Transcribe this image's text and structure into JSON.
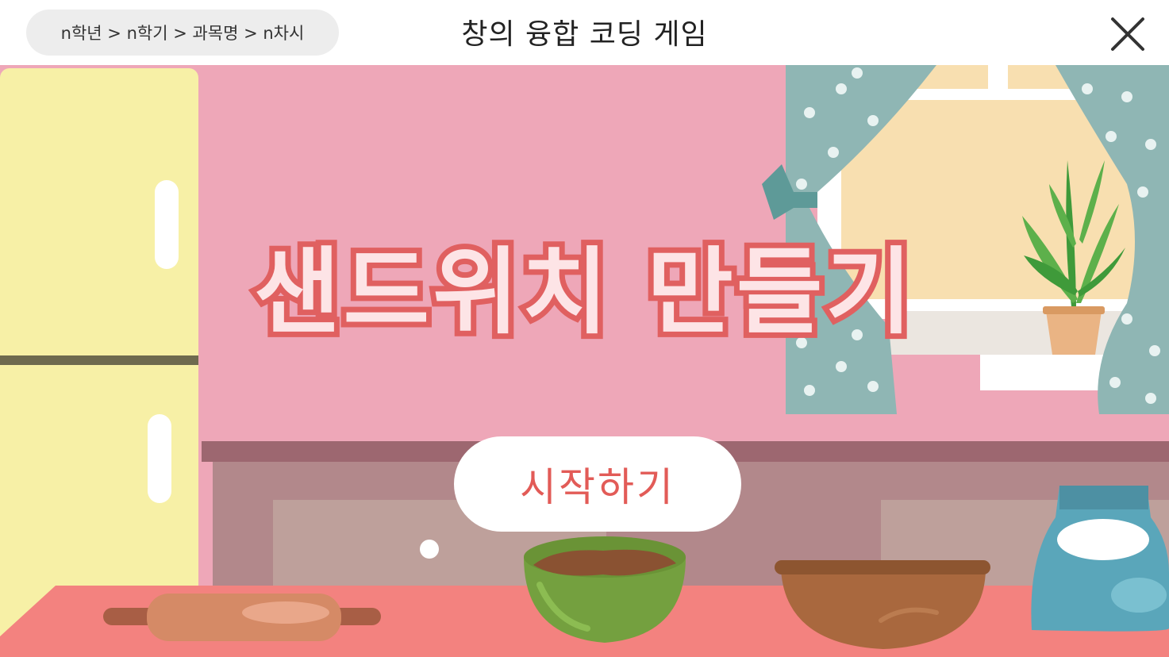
{
  "header": {
    "breadcrumb": "n학년 > n학기 > 과목명 > n차시",
    "title": "창의 융합 코딩 게임",
    "close_icon": "close-icon"
  },
  "game": {
    "title": "샌드위치 만들기",
    "start_label": "시작하기"
  },
  "colors": {
    "wall": "#eea7b8",
    "counter": "#f3827f",
    "fridge": "#f7f0a6",
    "title_fill": "#fde4e6",
    "title_stroke": "#e06060",
    "start_text": "#e25b57"
  }
}
